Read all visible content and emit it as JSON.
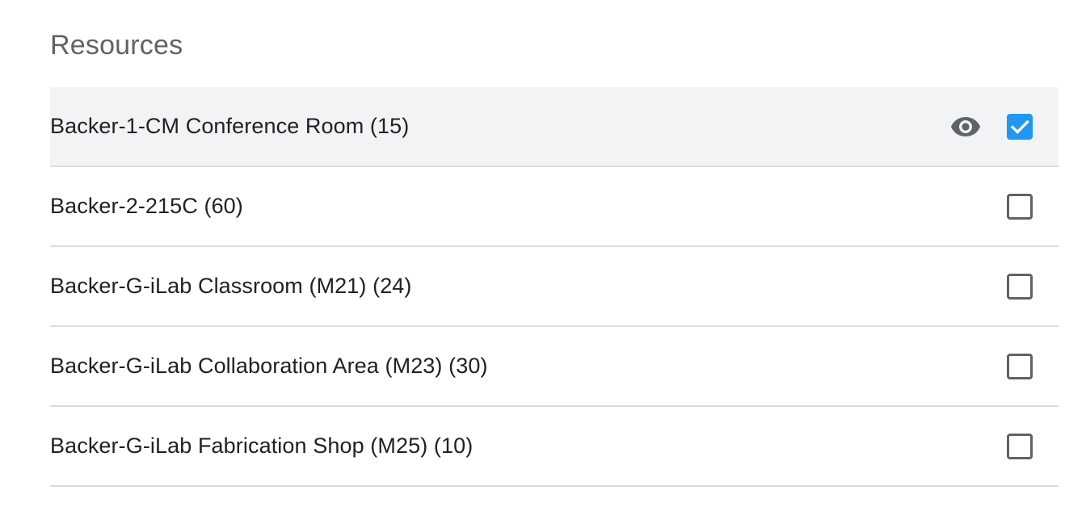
{
  "section": {
    "title": "Resources"
  },
  "resources": [
    {
      "label": "Backer-1-CM Conference Room (15)",
      "checked": true,
      "show_visibility_icon": true,
      "visibility_icon": "eye-icon"
    },
    {
      "label": "Backer-2-215C (60)",
      "checked": false,
      "show_visibility_icon": false
    },
    {
      "label": "Backer-G-iLab Classroom (M21) (24)",
      "checked": false,
      "show_visibility_icon": false
    },
    {
      "label": "Backer-G-iLab Collaboration Area (M23) (30)",
      "checked": false,
      "show_visibility_icon": false
    },
    {
      "label": "Backer-G-iLab Fabrication Shop (M25) (10)",
      "checked": false,
      "show_visibility_icon": false
    }
  ],
  "colors": {
    "checkbox_checked": "#2196f3",
    "checkbox_unchecked_border": "#5f6368",
    "highlight_row": "#f1f3f4",
    "divider": "#dadce0",
    "title_text": "#5f6368",
    "label_text": "#202124"
  }
}
